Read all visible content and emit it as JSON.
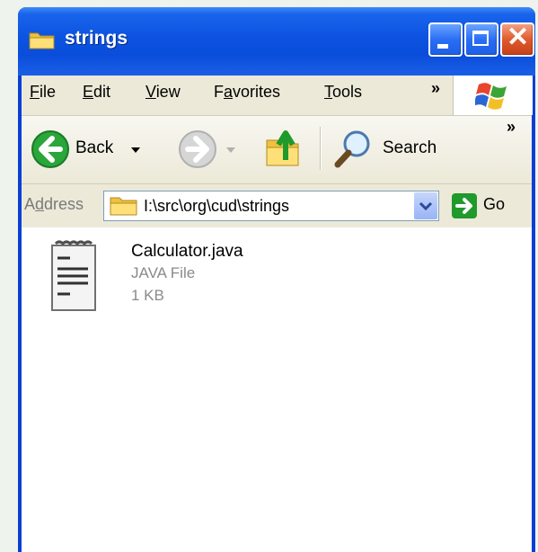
{
  "window": {
    "title": "strings"
  },
  "menu": {
    "items": [
      {
        "label": "File",
        "access_key": "F"
      },
      {
        "label": "Edit",
        "access_key": "E"
      },
      {
        "label": "View",
        "access_key": "V"
      },
      {
        "label": "Favorites",
        "access_key": "a"
      },
      {
        "label": "Tools",
        "access_key": "T"
      }
    ],
    "overflow": "»"
  },
  "toolbar": {
    "back_label": "Back",
    "search_label": "Search",
    "overflow": "»"
  },
  "address": {
    "label": "Address",
    "value": "I:\\src\\org\\cud\\strings",
    "go_label": "Go"
  },
  "files": [
    {
      "name": "Calculator.java",
      "type": "JAVA File",
      "size": "1 KB",
      "icon": "text-file-icon"
    }
  ],
  "colors": {
    "titlebar_blue": "#0a4ddb",
    "close_red": "#e15a2d",
    "go_green": "#1f9a2b",
    "window_bg": "#ece9d8"
  }
}
